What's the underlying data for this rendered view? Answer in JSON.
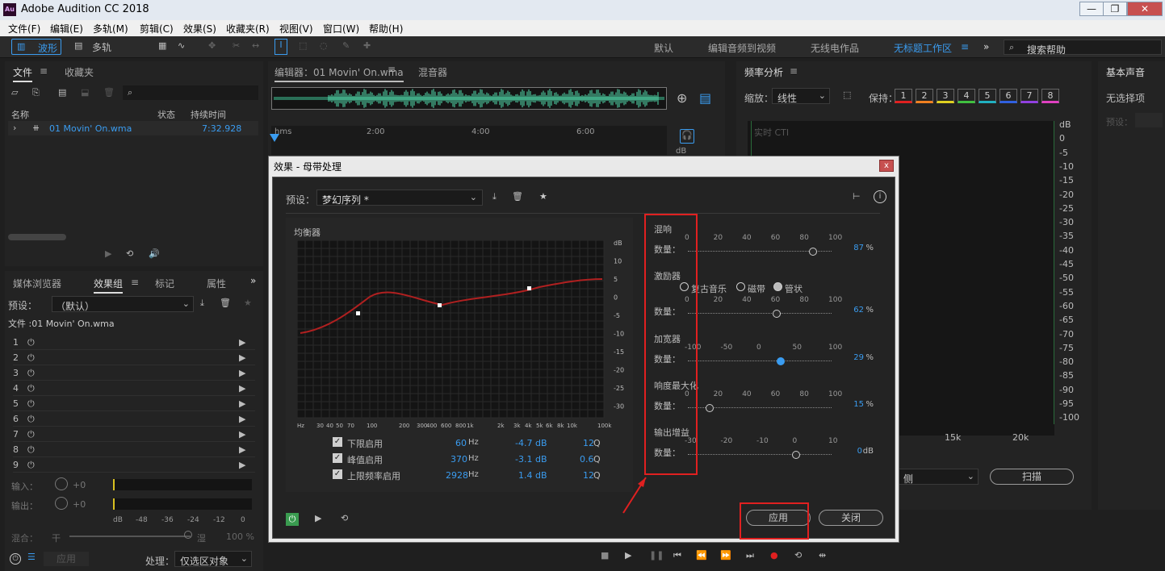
{
  "window": {
    "title": "Adobe Audition CC 2018",
    "logo": "Au",
    "minimize": "—",
    "restore": "❐",
    "close": "✕"
  },
  "menu": [
    "文件(F)",
    "编辑(E)",
    "多轨(M)",
    "剪辑(C)",
    "效果(S)",
    "收藏夹(R)",
    "视图(V)",
    "窗口(W)",
    "帮助(H)"
  ],
  "toolbar": {
    "waveform": "波形",
    "multitrack": "多轨",
    "workspaces": [
      "默认",
      "编辑音频到视频",
      "无线电作品",
      "无标题工作区"
    ],
    "search_placeholder": "搜索帮助"
  },
  "files_panel": {
    "tabs": [
      "文件",
      "收藏夹"
    ],
    "col_name": "名称",
    "col_status": "状态",
    "col_duration": "持续时间",
    "file": {
      "name": "01 Movin' On.wma",
      "duration": "7:32.928"
    }
  },
  "effects_panel": {
    "tabs": [
      "媒体浏览器",
      "效果组",
      "标记",
      "属性"
    ],
    "preset_label": "预设：",
    "preset_value": "（默认）",
    "file_label": "文件 :01 Movin' On.wma",
    "slots": [
      "1",
      "2",
      "3",
      "4",
      "5",
      "6",
      "7",
      "8",
      "9"
    ],
    "input_label": "输入：",
    "input_db": "+0",
    "output_label": "输出：",
    "output_db": "+0",
    "meter_ticks": [
      "dB",
      "-48",
      "-36",
      "-24",
      "-12",
      "0"
    ],
    "mix_label": "混合：",
    "mix_dry": "干",
    "mix_wet": "湿",
    "mix_pct": "100 %",
    "apply": "应用",
    "process_label": "处理：",
    "process_value": "仅选区对象"
  },
  "editor": {
    "tab": "编辑器：01 Movin' On.wma",
    "mixer_tab": "混音器",
    "ruler": [
      "hms",
      "2:00",
      "4:00",
      "6:00"
    ],
    "db": "dB"
  },
  "freq_panel": {
    "title": "频率分析",
    "zoom_label": "缩放：",
    "zoom_value": "线性",
    "hold_label": "保持：",
    "holds": [
      "1",
      "2",
      "3",
      "4",
      "5",
      "6",
      "7",
      "8"
    ],
    "hold_colors": [
      "#e02020",
      "#f08020",
      "#e0d020",
      "#40c040",
      "#20b0c0",
      "#3060e0",
      "#9040e0",
      "#e040c0"
    ],
    "live_label": "实时 CTI",
    "db_scale": [
      "dB",
      "0",
      "-5",
      "-10",
      "-15",
      "-20",
      "-25",
      "-30",
      "-35",
      "-40",
      "-45",
      "-50",
      "-55",
      "-60",
      "-65",
      "-70",
      "-75",
      "-80",
      "-85",
      "-90",
      "-95",
      "-100"
    ],
    "x_ticks": [
      "15k",
      "20k"
    ],
    "channel_value": "侧",
    "scan": "扫描"
  },
  "basic_sound": {
    "title": "基本声音",
    "none": "无选择项",
    "preset": "预设："
  },
  "dialog": {
    "title": "效果 - 母带处理",
    "close": "x",
    "preset_label": "预设：",
    "preset_value": "梦幻序列 *",
    "eq": {
      "title": "均衡器",
      "x_ticks": [
        "Hz",
        "30",
        "40",
        "50",
        "70",
        "100",
        "200",
        "300",
        "400",
        "600",
        "800",
        "1k",
        "2k",
        "3k",
        "4k",
        "5k",
        "6k",
        "8k",
        "10k",
        "100k"
      ],
      "db_ticks": [
        "dB",
        "10",
        "5",
        "0",
        "-5",
        "-10",
        "-15",
        "-20",
        "-25",
        "-30"
      ],
      "rows": [
        {
          "label": "下限启用",
          "hz": "60",
          "hz_unit": "Hz",
          "db": "-4.7 dB",
          "q": "12",
          "q_unit": "Q"
        },
        {
          "label": "峰值启用",
          "hz": "370",
          "hz_unit": "Hz",
          "db": "-3.1 dB",
          "q": "0.6",
          "q_unit": "Q"
        },
        {
          "label": "上限频率启用",
          "hz": "2928",
          "hz_unit": "Hz",
          "db": "1.4 dB",
          "q": "12",
          "q_unit": "Q"
        }
      ]
    },
    "reverb": {
      "title": "混响",
      "amount_label": "数量：",
      "ticks": [
        "0",
        "20",
        "40",
        "60",
        "80",
        "100"
      ],
      "value": "87",
      "unit": "%",
      "level": 0.87
    },
    "exciter": {
      "title": "激励器",
      "modes": [
        "复古音乐",
        "磁带",
        "管状"
      ],
      "amount_label": "数量：",
      "ticks": [
        "0",
        "20",
        "40",
        "60",
        "80",
        "100"
      ],
      "value": "62",
      "unit": "%",
      "level": 0.62
    },
    "widener": {
      "title": "加宽器",
      "amount_label": "数量：",
      "ticks": [
        "-100",
        "-50",
        "0",
        "50",
        "100"
      ],
      "value": "29",
      "unit": "%",
      "level": 0.29
    },
    "loudness": {
      "title": "响度最大化",
      "amount_label": "数量：",
      "ticks": [
        "0",
        "20",
        "40",
        "60",
        "80",
        "100"
      ],
      "value": "15",
      "unit": "%",
      "level": 0.15
    },
    "gain": {
      "title": "输出增益",
      "amount_label": "数量：",
      "ticks": [
        "-30",
        "-20",
        "-10",
        "0",
        "10"
      ],
      "value": "0",
      "unit": "dB",
      "level": 0.0
    },
    "apply": "应用",
    "close_btn": "关闭"
  }
}
